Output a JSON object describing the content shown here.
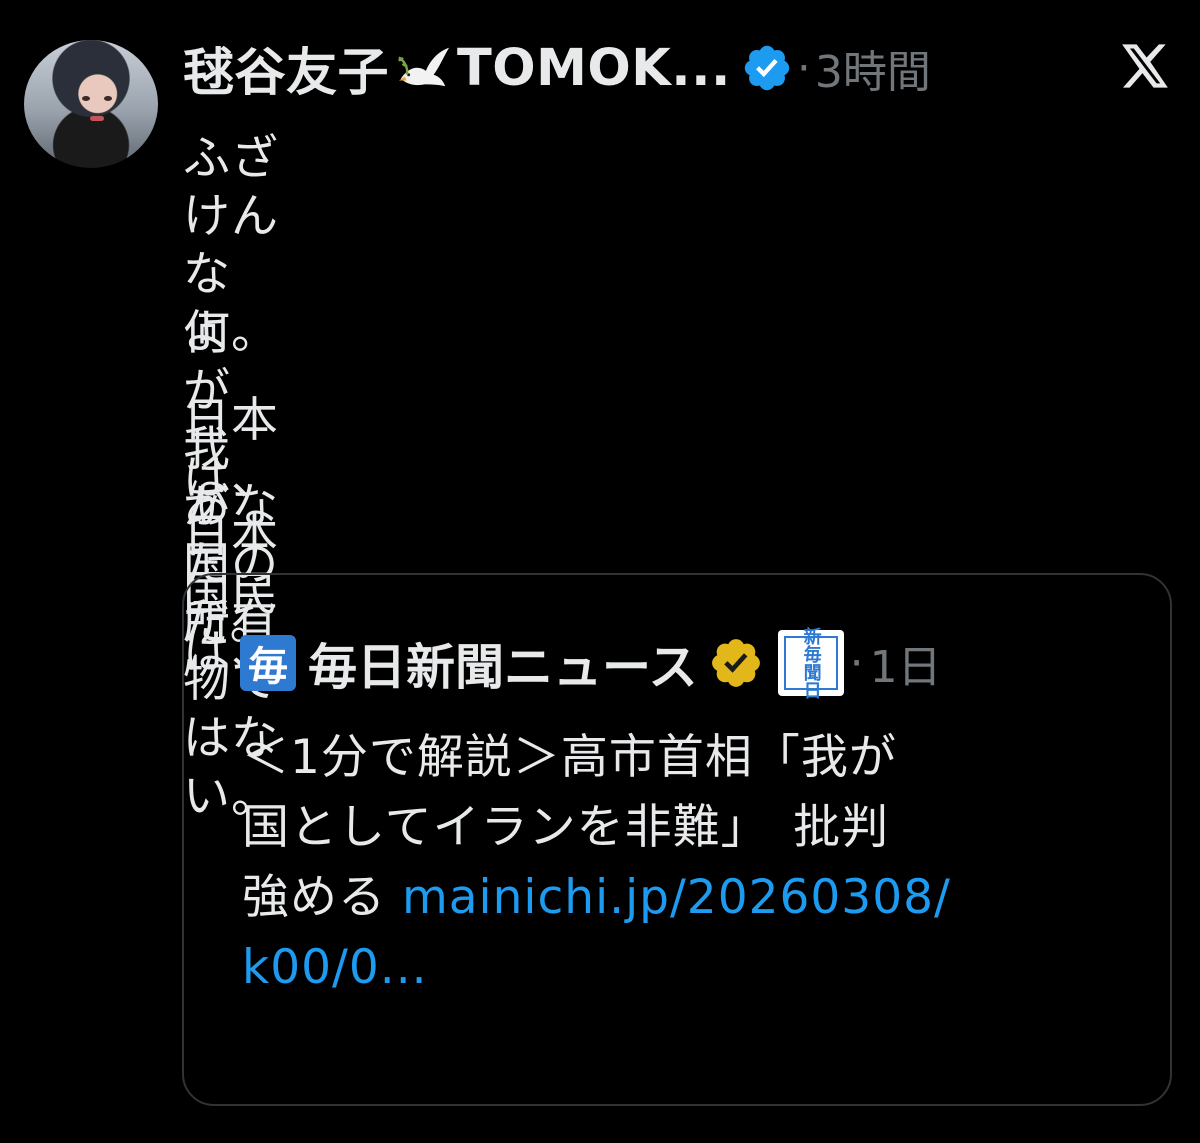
{
  "tweet": {
    "author_name": "毬谷友子",
    "author_suffix": "TOMOK...",
    "separator": "·",
    "timestamp": "3時間",
    "body_lines": [
      "ふざけんなよ。",
      "何が我が国だ。",
      "日本は、日本国民は、",
      "あなたの所有物ではない。"
    ],
    "icons": {
      "avatar": "avatar",
      "dove": "dove-with-olive-branch-icon",
      "verified": "verified-badge-blue-icon",
      "platform": "x-logo-icon"
    }
  },
  "quote": {
    "logo_small_text": "毎",
    "author_name": "毎日新聞ニュース",
    "logo_box_text": "新毎聞日",
    "separator": "·",
    "timestamp": "1日",
    "body_lines": [
      "＜1分で解説＞高市首相「我が",
      "国としてイランを非難」　批判"
    ],
    "body_line3_prefix": "強める ",
    "link_part1": "mainichi.jp/20260308/",
    "link_part2": "k00/0...",
    "icons": {
      "verified": "verified-badge-gold-icon",
      "org_logo": "mainichi-logo-icon"
    }
  },
  "colors": {
    "background": "#000000",
    "text": "#e7e9ea",
    "muted": "#71767b",
    "link": "#1d9bf0",
    "border": "#2f3336",
    "verified_blue": "#1d9bf0",
    "verified_gold": "#e2b719",
    "mainichi_blue": "#2e7ad1"
  }
}
